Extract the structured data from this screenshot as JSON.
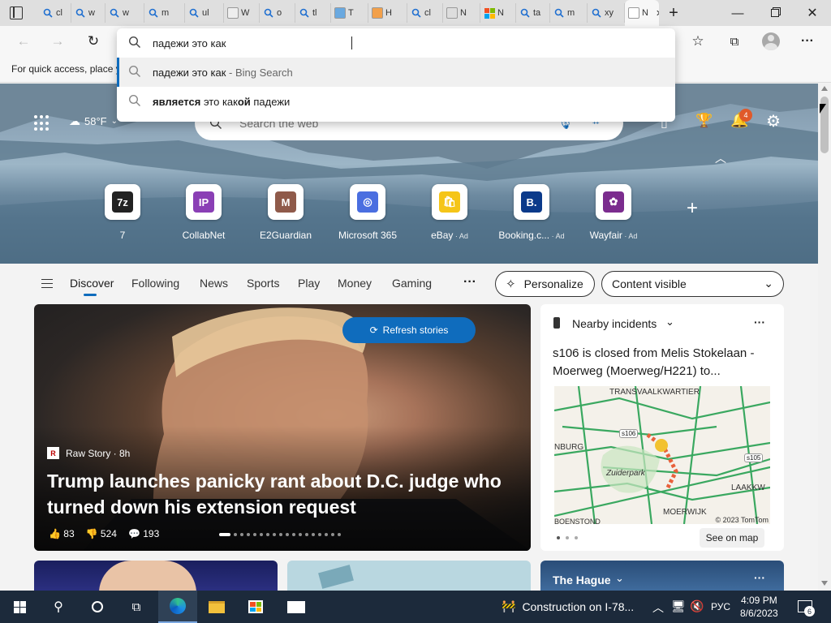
{
  "tabs": [
    {
      "label": "cl",
      "icon": "search-icon"
    },
    {
      "label": "w",
      "icon": "search-icon"
    },
    {
      "label": "w",
      "icon": "search-icon"
    },
    {
      "label": "m",
      "icon": "search-icon"
    },
    {
      "label": "ul",
      "icon": "search-icon"
    },
    {
      "label": "W",
      "icon": "wiki-icon"
    },
    {
      "label": "o",
      "icon": "search-icon"
    },
    {
      "label": "tl",
      "icon": "search-icon"
    },
    {
      "label": "T",
      "icon": "tl-icon"
    },
    {
      "label": "H",
      "icon": "hc-icon"
    },
    {
      "label": "cl",
      "icon": "search-icon"
    },
    {
      "label": "N",
      "icon": "news-icon"
    },
    {
      "label": "N",
      "icon": "microsoft-icon"
    },
    {
      "label": "ta",
      "icon": "search-icon"
    },
    {
      "label": "m",
      "icon": "search-icon"
    },
    {
      "label": "xy",
      "icon": "search-icon"
    },
    {
      "label": "N",
      "icon": "edge-icon"
    }
  ],
  "address": {
    "value": "падежи это как",
    "suggestions": [
      {
        "query": "падежи это как",
        "suffix": " - Bing Search"
      },
      {
        "parts": [
          {
            "t": "является",
            "b": true
          },
          {
            "t": " это как",
            "b": false
          },
          {
            "t": "ой",
            "b": true
          },
          {
            "t": " падежи",
            "b": false
          }
        ]
      }
    ]
  },
  "favbar_text": "For quick access, place y",
  "hero": {
    "weather": "58°F",
    "search_placeholder": "Search the web",
    "notif_count": "4",
    "quicklinks": [
      {
        "label": "7",
        "ad": "",
        "color": "#222",
        "glyph": "7z"
      },
      {
        "label": "CollabNet",
        "ad": "",
        "color": "#8a3fb5",
        "glyph": "IP"
      },
      {
        "label": "E2Guardian",
        "ad": "",
        "color": "#8f5a4a",
        "glyph": "M"
      },
      {
        "label": "Microsoft 365",
        "ad": "",
        "color": "#4a6ee0",
        "glyph": "◎"
      },
      {
        "label": "eBay",
        "ad": "Ad",
        "color": "#f5c518",
        "glyph": "🛍"
      },
      {
        "label": "Booking.c...",
        "ad": "Ad",
        "color": "#0b3a8a",
        "glyph": "B."
      },
      {
        "label": "Wayfair",
        "ad": "Ad",
        "color": "#7b2c8e",
        "glyph": "✿"
      }
    ]
  },
  "feednav": {
    "items": [
      "Discover",
      "Following",
      "News",
      "Sports",
      "Play",
      "Money",
      "Gaming"
    ],
    "more": "···",
    "personalize": "Personalize",
    "content_visible": "Content visible"
  },
  "main_story": {
    "refresh": "Refresh stories",
    "source": "Raw Story · 8h",
    "headline": "Trump launches panicky rant about D.C. judge who turned down his extension request",
    "likes": "83",
    "dislikes": "524",
    "comments": "193"
  },
  "traffic": {
    "title": "Nearby incidents",
    "more": "···",
    "headline": "s106 is closed from Melis Stokelaan - Moerweg (Moerweg/H221) to...",
    "map_labels": [
      "TRANSVAALKWARTIER",
      "NBURG",
      "Zuiderpark",
      "LAAKKW",
      "MOERWIJK",
      "s106",
      "s105",
      "BOENSTOND"
    ],
    "copyright": "© 2023 TomTom",
    "see_on_map": "See on map"
  },
  "bottom_card": {
    "title": "The Hague",
    "more": "···"
  },
  "taskbar": {
    "notification": "Construction on I-78...",
    "lang": "РУС",
    "time": "4:09 PM",
    "date": "8/6/2023",
    "badge": "6"
  }
}
